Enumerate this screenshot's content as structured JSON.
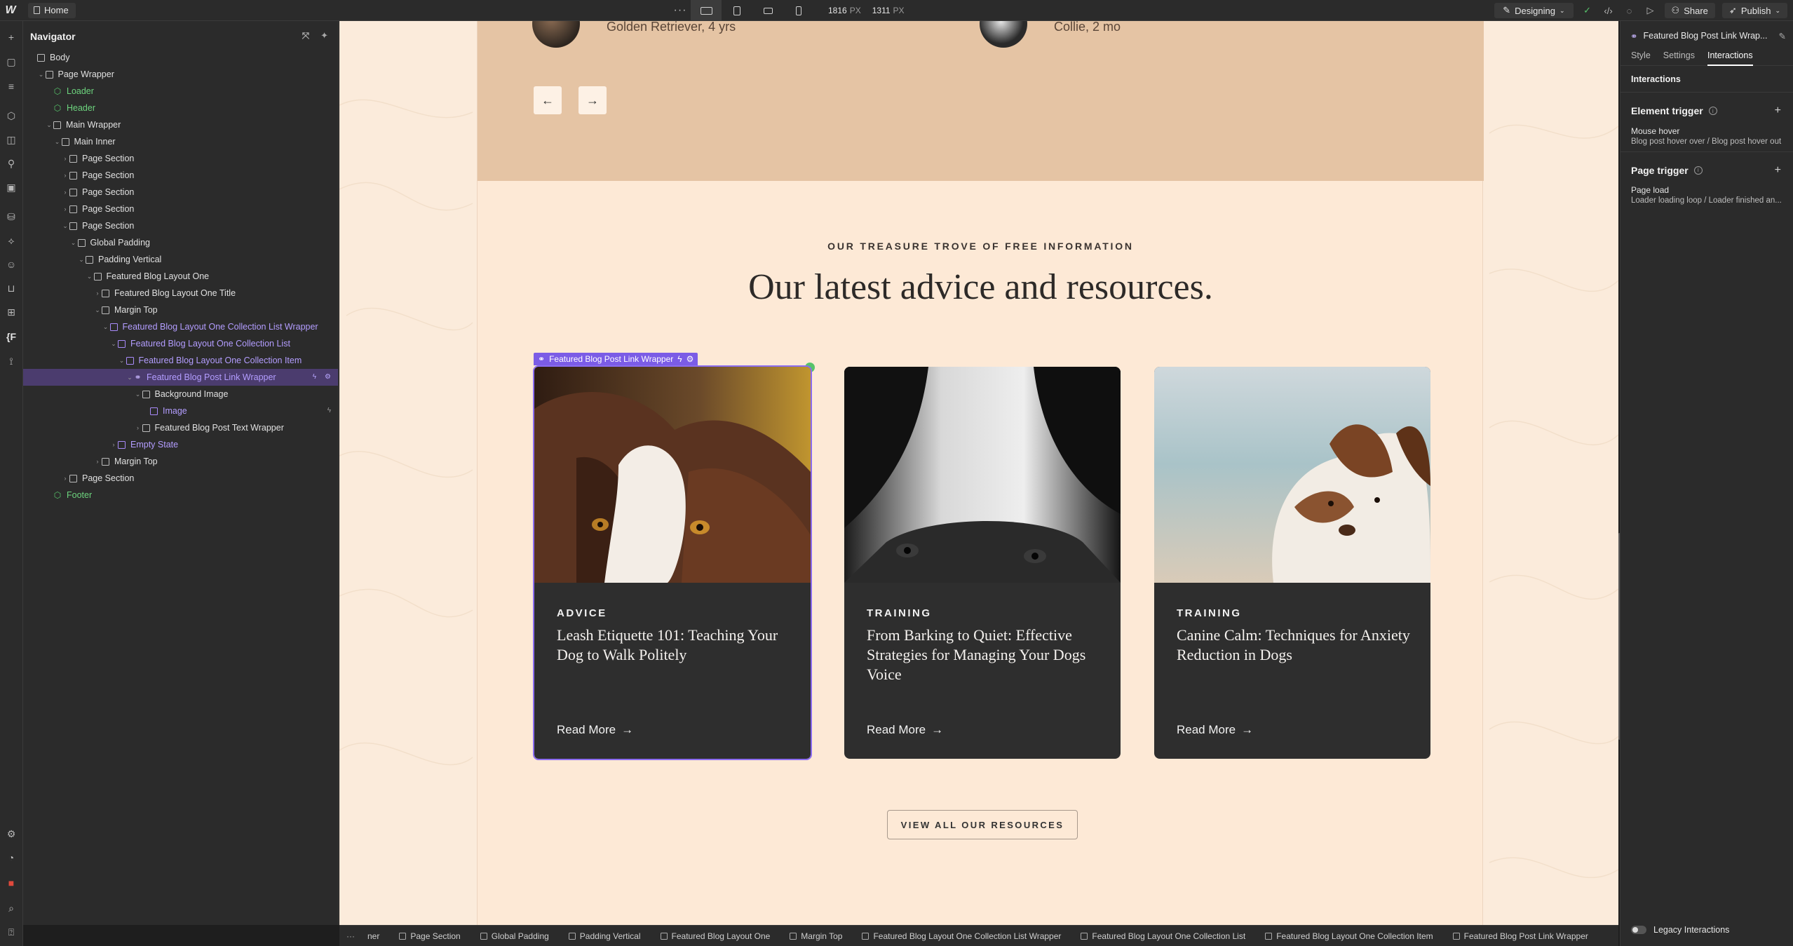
{
  "topbar": {
    "logo": "W",
    "home_label": "Home",
    "dots": "···",
    "width_value": "1816",
    "width_unit": "PX",
    "height_value": "1311",
    "height_unit": "PX",
    "mode_label": "Designing",
    "share_label": "Share",
    "publish_label": "Publish"
  },
  "navigator": {
    "title": "Navigator",
    "tree": [
      {
        "label": "Body",
        "depth": 0,
        "type": "box",
        "caret": ""
      },
      {
        "label": "Page Wrapper",
        "depth": 1,
        "type": "box",
        "caret": "open"
      },
      {
        "label": "Loader",
        "depth": 2,
        "type": "component",
        "caret": ""
      },
      {
        "label": "Header",
        "depth": 2,
        "type": "component",
        "caret": ""
      },
      {
        "label": "Main Wrapper",
        "depth": 2,
        "type": "box",
        "caret": "open"
      },
      {
        "label": "Main Inner",
        "depth": 3,
        "type": "box",
        "caret": "open"
      },
      {
        "label": "Page Section",
        "depth": 4,
        "type": "section",
        "caret": "closed"
      },
      {
        "label": "Page Section",
        "depth": 4,
        "type": "section",
        "caret": "closed"
      },
      {
        "label": "Page Section",
        "depth": 4,
        "type": "section",
        "caret": "closed"
      },
      {
        "label": "Page Section",
        "depth": 4,
        "type": "section",
        "caret": "closed"
      },
      {
        "label": "Page Section",
        "depth": 4,
        "type": "section",
        "caret": "open"
      },
      {
        "label": "Global Padding",
        "depth": 5,
        "type": "box",
        "caret": "open"
      },
      {
        "label": "Padding Vertical",
        "depth": 6,
        "type": "box",
        "caret": "open"
      },
      {
        "label": "Featured Blog Layout One",
        "depth": 7,
        "type": "box",
        "caret": "open"
      },
      {
        "label": "Featured Blog Layout One Title",
        "depth": 8,
        "type": "box",
        "caret": "closed"
      },
      {
        "label": "Margin Top",
        "depth": 8,
        "type": "box",
        "caret": "open"
      },
      {
        "label": "Featured Blog Layout One Collection List Wrapper",
        "depth": 9,
        "type": "collection",
        "caret": "open"
      },
      {
        "label": "Featured Blog Layout One Collection List",
        "depth": 10,
        "type": "collection",
        "caret": "open"
      },
      {
        "label": "Featured Blog Layout One Collection Item",
        "depth": 11,
        "type": "collection",
        "caret": "open"
      },
      {
        "label": "Featured Blog Post Link Wrapper",
        "depth": 12,
        "type": "link",
        "caret": "open",
        "selected": true
      },
      {
        "label": "Background Image",
        "depth": 13,
        "type": "box",
        "caret": "open"
      },
      {
        "label": "Image",
        "depth": 14,
        "type": "image",
        "caret": ""
      },
      {
        "label": "Featured Blog Post Text Wrapper",
        "depth": 13,
        "type": "box",
        "caret": "closed"
      },
      {
        "label": "Empty State",
        "depth": 10,
        "type": "collection",
        "caret": "closed"
      },
      {
        "label": "Margin Top",
        "depth": 8,
        "type": "box",
        "caret": "closed"
      },
      {
        "label": "Page Section",
        "depth": 4,
        "type": "section",
        "caret": "closed"
      },
      {
        "label": "Footer",
        "depth": 2,
        "type": "component",
        "caret": ""
      }
    ]
  },
  "canvas": {
    "testimonials": [
      {
        "caption": "Golden Retriever, 4 yrs"
      },
      {
        "caption": "Collie, 2 mo"
      }
    ],
    "eyebrow": "OUR TREASURE TROVE OF FREE INFORMATION",
    "headline": "Our latest advice and resources.",
    "selection_label": "Featured Blog Post Link Wrapper",
    "cards": [
      {
        "category": "ADVICE",
        "title": "Leash Etiquette 101: Teaching Your Dog to Walk Politely",
        "link": "Read More"
      },
      {
        "category": "TRAINING",
        "title": "From Barking to Quiet: Effective Strategies for Managing Your Dogs Voice",
        "link": "Read More"
      },
      {
        "category": "TRAINING",
        "title": "Canine Calm: Techniques for Anxiety Reduction in Dogs",
        "link": "Read More"
      }
    ],
    "view_all": "VIEW ALL OUR RESOURCES"
  },
  "breadcrumbs": [
    "ner",
    "Page Section",
    "Global Padding",
    "Padding Vertical",
    "Featured Blog Layout One",
    "Margin Top",
    "Featured Blog Layout One Collection List Wrapper",
    "Featured Blog Layout One Collection List",
    "Featured Blog Layout One Collection Item",
    "Featured Blog Post Link Wrapper"
  ],
  "right_panel": {
    "element_name": "Featured Blog Post Link Wrap...",
    "tabs": [
      "Style",
      "Settings",
      "Interactions"
    ],
    "active_tab": "Interactions",
    "section_title": "Interactions",
    "element_trigger": {
      "title": "Element trigger",
      "item_title": "Mouse hover",
      "item_sub": "Blog post hover over / Blog post hover out"
    },
    "page_trigger": {
      "title": "Page trigger",
      "item_title": "Page load",
      "item_sub": "Loader loading loop / Loader finished an..."
    },
    "legacy_label": "Legacy Interactions"
  },
  "colors": {
    "accent_purple": "#7b5ce6",
    "component_green": "#6dd47e",
    "canvas_bg": "#fde9d6",
    "card_bg": "#2e2e2e",
    "testimonial_bg": "#e5c4a4"
  }
}
